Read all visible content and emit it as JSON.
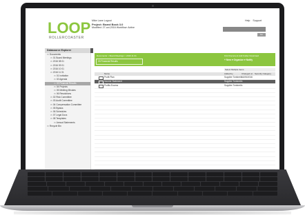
{
  "app": {
    "logo_text": "LOOP",
    "tagline": "ROLLERCOASTER"
  },
  "header": {
    "user_line": "Mike Lane   Logout",
    "project": "Project: Board Book 3.0",
    "project_meta": "Modified: 27-oct-2016   Workflow: Active",
    "help": "Help",
    "support": "Support",
    "search_button": "Go"
  },
  "sidebar": {
    "title": "Datasource Explorer",
    "items": [
      {
        "label": "Documents",
        "indent": 0,
        "selected": false
      },
      {
        "label": "01 Board Meetings",
        "indent": 1,
        "selected": false
      },
      {
        "label": "2016 08 01",
        "indent": 1,
        "selected": false
      },
      {
        "label": "2016 09 01",
        "indent": 1,
        "selected": false
      },
      {
        "label": "2016 10 01",
        "indent": 1,
        "selected": false
      },
      {
        "label": "2016 11 01",
        "indent": 1,
        "selected": false
      },
      {
        "label": "01 Invitation",
        "indent": 2,
        "selected": false
      },
      {
        "label": "02 Agenda",
        "indent": 2,
        "selected": false
      },
      {
        "label": "03 Financial Results",
        "indent": 2,
        "selected": true
      },
      {
        "label": "04 Projects",
        "indent": 2,
        "selected": false
      },
      {
        "label": "05 Meeting Minutes",
        "indent": 2,
        "selected": false
      },
      {
        "label": "06 Resolutions",
        "indent": 2,
        "selected": false
      },
      {
        "label": "02 Risk Committee",
        "indent": 1,
        "selected": false
      },
      {
        "label": "03 Audit Committee",
        "indent": 1,
        "selected": false
      },
      {
        "label": "04 Compensation Committee",
        "indent": 1,
        "selected": false
      },
      {
        "label": "05 Bylaws",
        "indent": 1,
        "selected": false
      },
      {
        "label": "06 Schedules",
        "indent": 1,
        "selected": false
      },
      {
        "label": "07 Legal Docs",
        "indent": 1,
        "selected": false
      },
      {
        "label": "08 Templates",
        "indent": 1,
        "selected": false
      },
      {
        "label": "Annual Statements",
        "indent": 2,
        "selected": false
      },
      {
        "label": "Recycle Bin",
        "indent": 0,
        "selected": false
      }
    ]
  },
  "tabs": [
    "Files",
    "Folders",
    "Messages",
    "Calendar",
    "Members",
    "Workflow",
    "Document Activity"
  ],
  "main": {
    "breadcrumb": "Documents > Board Meetings > 2016 11 01",
    "folder_name": "03 Financial Results",
    "links": "Find Document    Add Folder    Download",
    "actions": "+ New    ▾ Organize    ▾ Notify",
    "select_label": "Select Multiple Items"
  },
  "grid": {
    "headers": [
      "Name",
      "Added by",
      "Changed on",
      "Security Category"
    ],
    "rows": [
      {
        "name": "Profit Plan",
        "added_by": "Supplier Tomberlin",
        "changed": "10/26/2016",
        "category": "",
        "highlight": false
      },
      {
        "name": "Income Statement",
        "added_by": "Supplier Tomberlin",
        "changed": "",
        "category": "",
        "highlight": true
      },
      {
        "name": "Profits Excess",
        "added_by": "Supplier Tomberlin",
        "changed": "",
        "category": "",
        "highlight": false
      }
    ]
  },
  "colors": {
    "accent": "#8cc63f",
    "bezel": "#1b1b1d"
  }
}
